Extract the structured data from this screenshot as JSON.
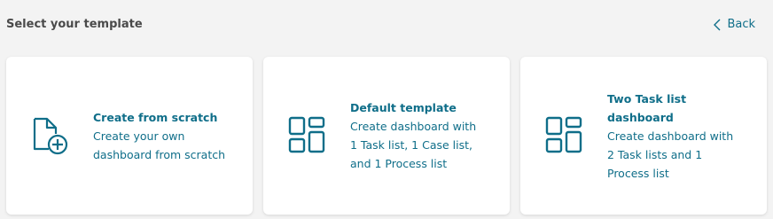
{
  "header": {
    "title": "Select your template",
    "back_label": "Back"
  },
  "accent_color": "#0f6e89",
  "templates": [
    {
      "name": "Create from scratch",
      "description": "Create your own dashboard from scratch",
      "icon": "file-add-icon"
    },
    {
      "name": "Default template",
      "description": "Create dashboard with 1 Task list, 1 Case list, and 1 Process list",
      "icon": "dashboard-layout-icon"
    },
    {
      "name": "Two Task list dashboard",
      "description": "Create dashboard with 2 Task lists and 1 Process list",
      "icon": "dashboard-layout-icon"
    }
  ]
}
